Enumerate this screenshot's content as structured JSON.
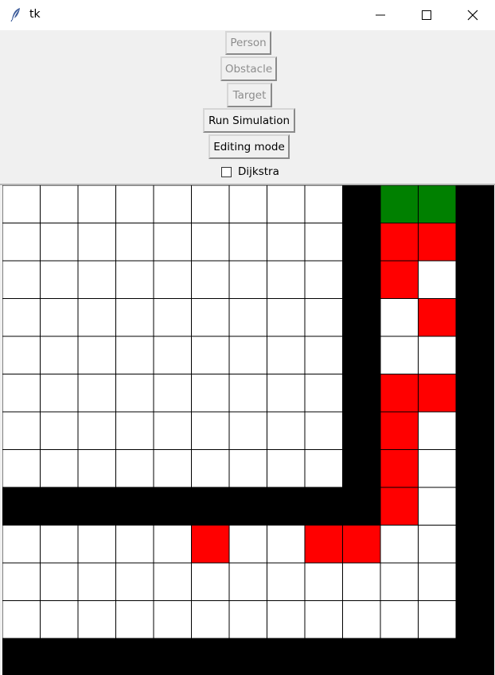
{
  "window": {
    "title": "tk",
    "icon": "feather-icon",
    "controls": [
      "minimize-icon",
      "maximize-icon",
      "close-icon"
    ]
  },
  "toolbar": {
    "person_label": "Person",
    "obstacle_label": "Obstacle",
    "target_label": "Target",
    "run_label": "Run Simulation",
    "editing_label": "Editing mode",
    "dijkstra_label": "Dijkstra",
    "dijkstra_checked": false
  },
  "grid": {
    "rows": 13,
    "cols": 13,
    "legend": {
      "W": "#ffffff",
      "B": "#000000",
      "R": "#ff0000",
      "G": "#008000"
    },
    "cells": [
      "WWWWWWWWWBGGB",
      "WWWWWWWWWBRRB",
      "WWWWWWWWWBRWB",
      "WWWWWWWWWBWRB",
      "WWWWWWWWWBWWB",
      "WWWWWWWWWBRRB",
      "WWWWWWWWWBRWB",
      "WWWWWWWWWBRWB",
      "BBBBBBBBBBRWB",
      "WWWWWRWWRRWWB",
      "WWWWWWWWWWWWB",
      "WWWWWWWWWWWWB",
      "BBBBBBBBBBBBB"
    ]
  }
}
